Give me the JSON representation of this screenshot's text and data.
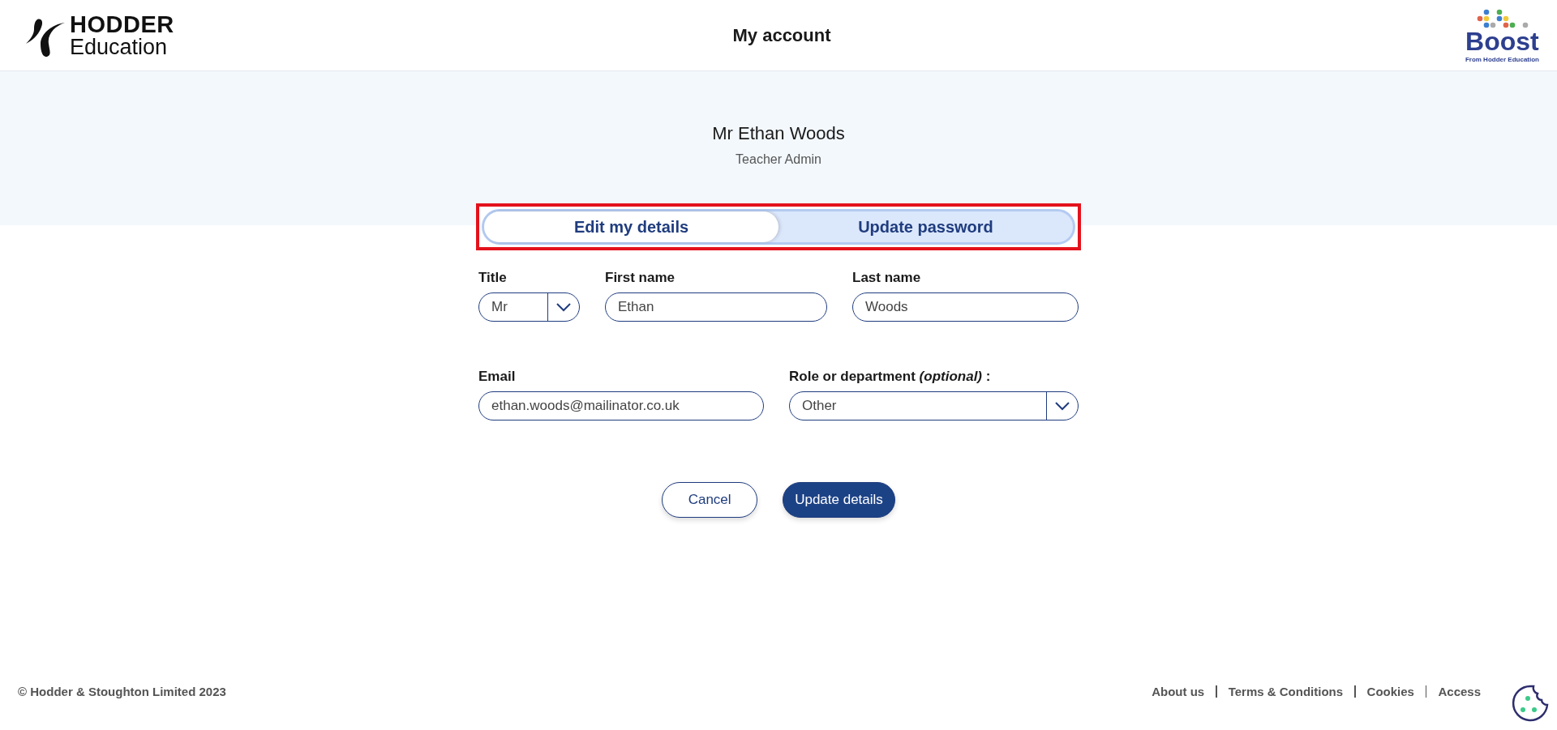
{
  "header": {
    "logo": {
      "line_1": "HODDER",
      "line_2": "Education"
    },
    "title": "My account",
    "brand": {
      "name": "Boost",
      "tagline": "From Hodder Education"
    }
  },
  "profile": {
    "name": "Mr Ethan Woods",
    "role": "Teacher Admin"
  },
  "tabs_highlighted": true,
  "tabs": [
    {
      "label": "Edit my details",
      "selected": true
    },
    {
      "label": "Update password",
      "selected": false
    }
  ],
  "form": {
    "title": {
      "kind": "select",
      "label": "Title",
      "value": "Mr"
    },
    "first_name": {
      "kind": "text",
      "label": "First name",
      "value": "Ethan"
    },
    "last_name": {
      "kind": "text",
      "label": "Last name",
      "value": "Woods"
    },
    "email": {
      "kind": "text",
      "label": "Email",
      "value": "ethan.woods@mailinator.co.uk"
    },
    "role": {
      "kind": "select",
      "label": "Role or department *(optional)* :",
      "value": "Other"
    }
  },
  "buttons": [
    {
      "kind": "secondary",
      "label": "Cancel"
    },
    {
      "kind": "primary",
      "label": "Update details"
    }
  ],
  "footer": {
    "copyright": "© Hodder & Stoughton Limited 2023",
    "links": [
      "About us",
      "Terms & Conditions",
      "Cookies",
      "Access"
    ]
  }
}
